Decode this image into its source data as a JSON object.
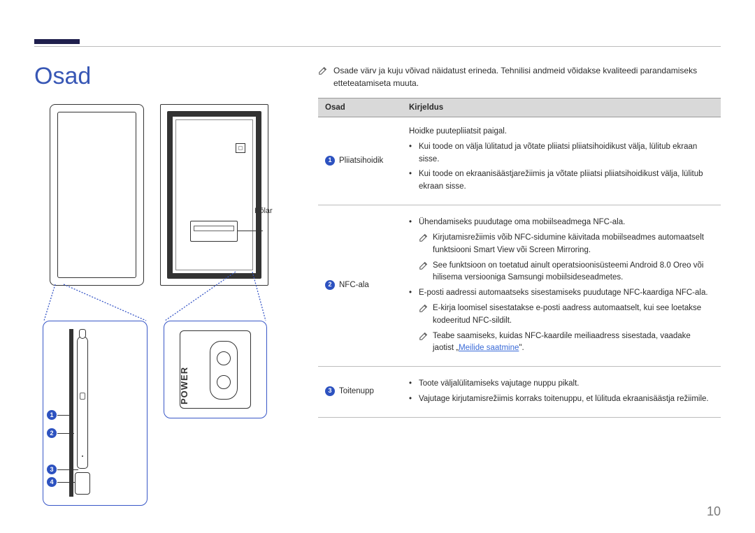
{
  "title": "Osad",
  "page_number": "10",
  "speaker_label": "Kõlar",
  "power_label": "POWER",
  "top_note": "Osade värv ja kuju võivad näidatust erineda. Tehnilisi andmeid võidakse kvaliteedi parandamiseks etteteatamiseta muuta.",
  "table": {
    "headers": {
      "part": "Osad",
      "desc": "Kirjeldus"
    },
    "rows": [
      {
        "num": "1",
        "part": "Pliiatsihoidik",
        "intro": "Hoidke puutepliiatsit paigal.",
        "bullets": [
          "Kui toode on välja lülitatud ja võtate pliiatsi pliiatsihoidikust välja, lülitub ekraan sisse.",
          "Kui toode on ekraanisäästjarežiimis ja võtate pliiatsi pliiatsihoidikust välja, lülitub ekraan sisse."
        ]
      },
      {
        "num": "2",
        "part": "NFC-ala",
        "b1": "Ühendamiseks puudutage oma mobiilseadmega NFC-ala.",
        "note1": "Kirjutamisrežiimis võib NFC-sidumine käivitada mobiilseadmes automaatselt funktsiooni Smart View või Screen Mirroring.",
        "note2": "See funktsioon on toetatud ainult operatsioonisüsteemi Android 8.0 Oreo või hilisema versiooniga Samsungi mobiilsideseadmetes.",
        "b2": "E-posti aadressi automaatseks sisestamiseks puudutage NFC-kaardiga NFC-ala.",
        "note3": "E-kirja loomisel sisestatakse e-posti aadress automaatselt, kui see loetakse kodeeritud NFC-sildilt.",
        "note4_pre": "Teabe saamiseks, kuidas NFC-kaardile meiliaadress sisestada, vaadake jaotist „",
        "note4_link": "Meilide saatmine",
        "note4_post": "\"."
      },
      {
        "num": "3",
        "part": "Toitenupp",
        "bullets": [
          "Toote väljalülitamiseks vajutage nuppu pikalt.",
          "Vajutage kirjutamisrežiimis korraks toitenuppu, et lülituda ekraanisäästja režiimile."
        ]
      }
    ]
  }
}
